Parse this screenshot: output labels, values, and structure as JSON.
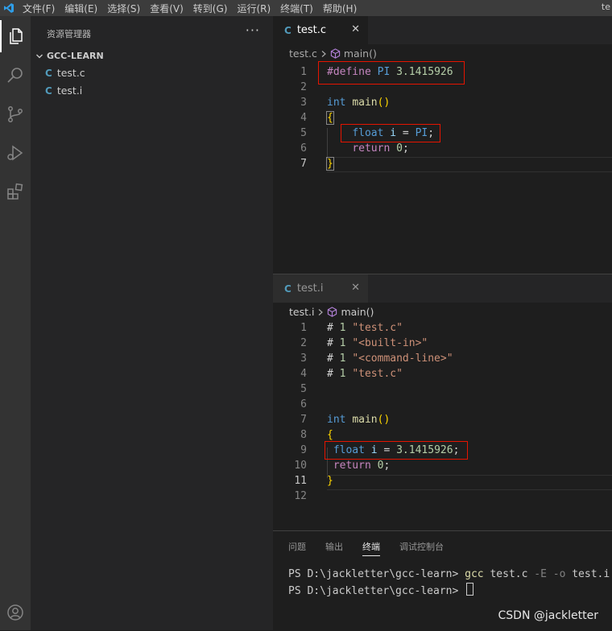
{
  "menubar": {
    "items": [
      "文件(F)",
      "编辑(E)",
      "选择(S)",
      "查看(V)",
      "转到(G)",
      "运行(R)",
      "终端(T)",
      "帮助(H)"
    ],
    "title_fragment": "te"
  },
  "sidebar": {
    "header": "资源管理器",
    "more": "···",
    "folder": "GCC-LEARN",
    "files": [
      "test.c",
      "test.i"
    ]
  },
  "editor_top": {
    "tab_label": "test.c",
    "tab_close": "✕",
    "breadcrumb_file": "test.c",
    "breadcrumb_symbol": "main()",
    "line_numbers": [
      "1",
      "2",
      "3",
      "4",
      "5",
      "6",
      "7"
    ],
    "lines": {
      "l1_directive": "#define",
      "l1_name": "PI",
      "l1_value": "3.1415926",
      "l3_type": "int",
      "l3_func": "main",
      "l3_parens": "()",
      "l4_brace": "{",
      "l5_type": "float",
      "l5_var": "i",
      "l5_op": " = ",
      "l5_val": "PI",
      "l5_semi": ";",
      "l6_kw": "return",
      "l6_num": "0",
      "l6_semi": ";",
      "l7_brace": "}"
    }
  },
  "editor_bottom": {
    "tab_label": "test.i",
    "tab_close": "✕",
    "breadcrumb_file": "test.i",
    "breadcrumb_symbol": "main()",
    "line_numbers": [
      "1",
      "2",
      "3",
      "4",
      "5",
      "6",
      "7",
      "8",
      "9",
      "10",
      "11",
      "12"
    ],
    "lines": {
      "hash": "# ",
      "one": "1",
      "l1_str": "\"test.c\"",
      "l2_str": "\"<built-in>\"",
      "l3_str": "\"<command-line>\"",
      "l4_str": "\"test.c\"",
      "l7_type": "int",
      "l7_func": "main",
      "l7_parens": "()",
      "l8_brace": "{",
      "l9_type": "float",
      "l9_var": "i",
      "l9_op": " = ",
      "l9_val": "3.1415926",
      "l9_semi": ";",
      "l10_kw": "return",
      "l10_num": "0",
      "l10_semi": ";",
      "l11_brace": "}"
    }
  },
  "panel": {
    "tabs": [
      "问题",
      "输出",
      "终端",
      "调试控制台"
    ],
    "active_tab": "终端",
    "terminal": {
      "prompt": "PS D:\\jackletter\\gcc-learn> ",
      "command": "gcc",
      "args": " test.c ",
      "flags": "-E -o",
      "output": " test.i"
    }
  },
  "watermark": "CSDN @jackletter",
  "colors": {
    "accent": "#007acc",
    "highlight_box": "#e51400",
    "c_icon": "#519aba"
  }
}
